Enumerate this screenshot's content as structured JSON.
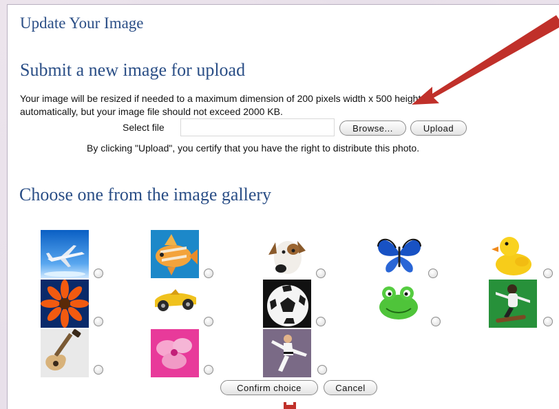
{
  "page": {
    "title": "Update Your Image",
    "upload_heading": "Submit a new image for upload",
    "description_line1": "Your image will be resized if needed to a maximum dimension of 200 pixels width x 500 height",
    "description_line2": "automatically, but your image file should not exceed 2000 KB.",
    "select_file_label": "Select file",
    "browse_label": "Browse...",
    "upload_label": "Upload",
    "certify_text": "By clicking \"Upload\", you certify that you have the right to distribute this photo.",
    "gallery_heading": "Choose one from the image gallery",
    "confirm_label": "Confirm choice",
    "cancel_label": "Cancel"
  },
  "gallery": [
    {
      "name": "airplane-image",
      "icon": "airplane"
    },
    {
      "name": "fish-image",
      "icon": "fish"
    },
    {
      "name": "dog-image",
      "icon": "dog"
    },
    {
      "name": "butterfly-image",
      "icon": "butterfly"
    },
    {
      "name": "duck-image",
      "icon": "rubber-duck"
    },
    {
      "name": "flower-image",
      "icon": "orange-flower"
    },
    {
      "name": "race-car-image",
      "icon": "toy-car"
    },
    {
      "name": "soccer-ball-image",
      "icon": "soccer-ball"
    },
    {
      "name": "frog-image",
      "icon": "frog"
    },
    {
      "name": "skateboarder-image",
      "icon": "skateboarder"
    },
    {
      "name": "guitar-image",
      "icon": "bass-guitar"
    },
    {
      "name": "pink-flower-image",
      "icon": "pink-flower"
    },
    {
      "name": "karate-image",
      "icon": "karate"
    }
  ],
  "colors": {
    "heading": "#2a4e86",
    "arrow": "#c0302a"
  }
}
